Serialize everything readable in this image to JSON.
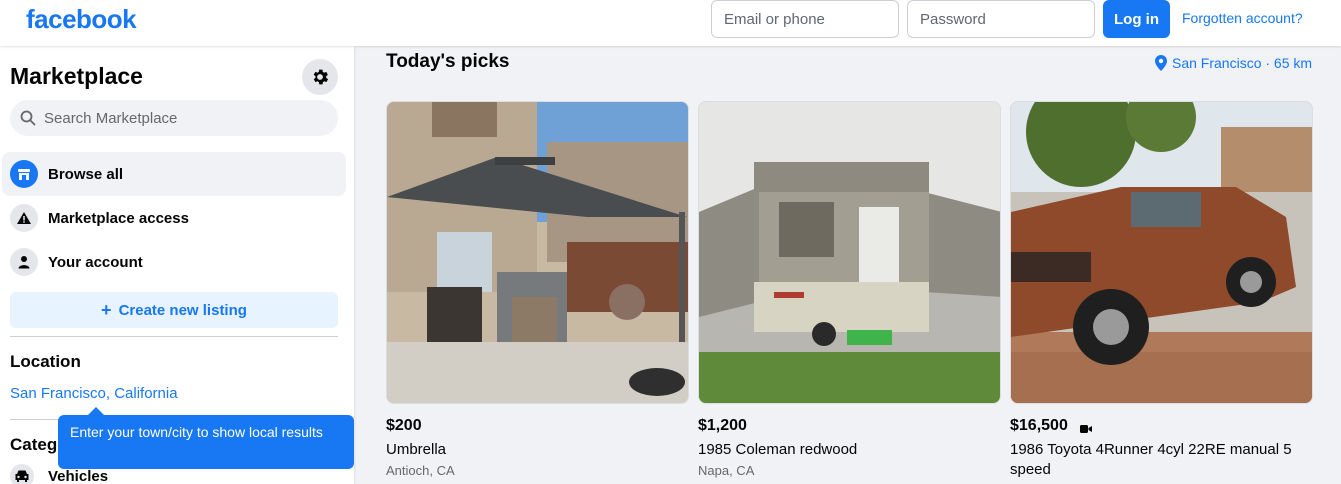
{
  "header": {
    "logo": "facebook",
    "email_placeholder": "Email or phone",
    "password_placeholder": "Password",
    "login_label": "Log in",
    "forgot_label": "Forgotten account?"
  },
  "sidebar": {
    "title": "Marketplace",
    "search_placeholder": "Search Marketplace",
    "nav": [
      {
        "label": "Browse all",
        "icon": "storefront-icon",
        "active": true
      },
      {
        "label": "Marketplace access",
        "icon": "warning-icon",
        "active": false
      },
      {
        "label": "Your account",
        "icon": "person-icon",
        "active": false
      }
    ],
    "create_label": "Create new listing",
    "location_heading": "Location",
    "location_value": "San Francisco, California",
    "categories_heading": "Categories",
    "categories": [
      {
        "label": "Vehicles",
        "icon": "car-icon"
      }
    ],
    "tooltip": "Enter your town/city to show local results"
  },
  "main": {
    "title": "Today's picks",
    "location": "San Francisco · 65 km",
    "listings": [
      {
        "price": "$200",
        "title": "Umbrella",
        "place": "Antioch, CA",
        "video": false
      },
      {
        "price": "$1,200",
        "title": "1985 Coleman redwood",
        "place": "Napa, CA",
        "video": false
      },
      {
        "price": "$16,500",
        "title": "1986 Toyota 4Runner 4cyl 22RE manual 5 speed",
        "place": "",
        "video": true
      }
    ]
  },
  "colors": {
    "brand": "#1877f2",
    "page_bg": "#f0f2f5",
    "secondary_text": "#65676b"
  }
}
